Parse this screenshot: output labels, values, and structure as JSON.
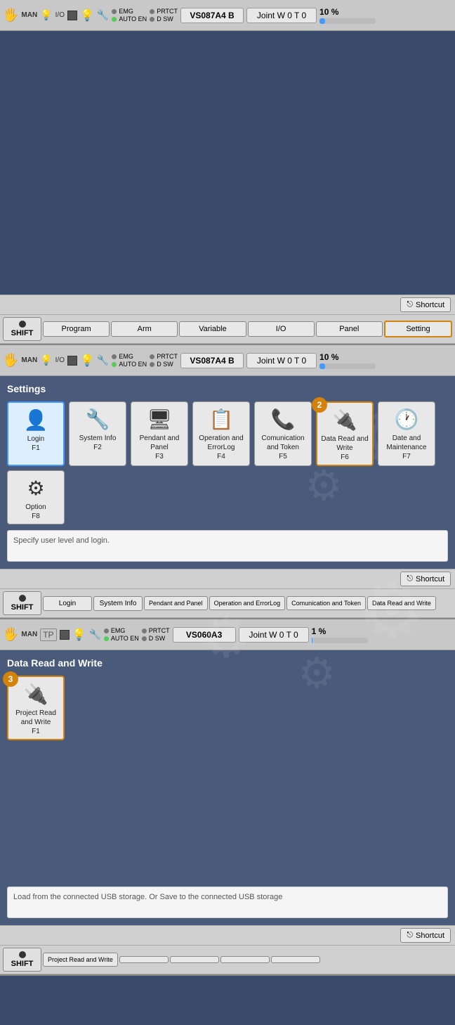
{
  "section1": {
    "statusbar": {
      "man_label": "MAN",
      "io_label": "I/O",
      "emg_label": "EMG",
      "prtct_label": "PRTCT",
      "auto_en_label": "AUTO EN",
      "d_sw_label": "D SW",
      "robot_id": "VS087A4 B",
      "joint_label": "Joint W 0 T 0",
      "percent": "10 %",
      "progress": 10
    },
    "shortcut_label": "Shortcut",
    "nav": {
      "shift_label": "SHIFT",
      "buttons": [
        "Program",
        "Arm",
        "Variable",
        "I/O",
        "Panel",
        "Setting"
      ],
      "active": "Setting"
    }
  },
  "section2": {
    "statusbar": {
      "man_label": "MAN",
      "io_label": "I/O",
      "emg_label": "EMG",
      "prtct_label": "PRTCT",
      "auto_en_label": "AUTO EN",
      "d_sw_label": "D SW",
      "robot_id": "VS087A4 B",
      "joint_label": "Joint W 0 T 0",
      "percent": "10 %",
      "progress": 10
    },
    "settings_title": "Settings",
    "shortcut_label": "Shortcut",
    "badge_num": "2",
    "items": [
      {
        "id": "login",
        "label": "Login\nF1",
        "icon": "👤",
        "active": true
      },
      {
        "id": "sysinfo",
        "label": "System Info\nF2",
        "icon": "🔧",
        "active": false
      },
      {
        "id": "pendant",
        "label": "Pendant and Panel\nF3",
        "icon": "🖥",
        "active": false
      },
      {
        "id": "operation",
        "label": "Operation and ErrorLog\nF4",
        "icon": "📋",
        "active": false
      },
      {
        "id": "communication",
        "label": "Comunication and Token\nF5",
        "icon": "📞",
        "active": false
      },
      {
        "id": "dataread",
        "label": "Data Read and Write\nF6",
        "icon": "🔌",
        "highlighted": true
      },
      {
        "id": "datetime",
        "label": "Date and Maintenance\nF7",
        "icon": "🕐",
        "active": false
      },
      {
        "id": "option",
        "label": "Option\nF8",
        "icon": "⚙",
        "active": false
      }
    ],
    "description": "Specify user level and login.",
    "nav": {
      "shift_label": "SHIFT",
      "buttons": [
        "Login",
        "System Info",
        "Pendant and Panel",
        "Operation and ErrorLog",
        "Comunication and Token",
        "Data Read and Write"
      ]
    }
  },
  "section3": {
    "statusbar": {
      "man_label": "MAN",
      "tp_label": "TP",
      "emg_label": "EMG",
      "prtct_label": "PRTCT",
      "auto_en_label": "AUTO EN",
      "d_sw_label": "D SW",
      "robot_id": "VS060A3",
      "joint_label": "Joint W 0 T 0",
      "percent": "1 %",
      "progress": 1
    },
    "panel_title": "Data Read and Write",
    "shortcut_label": "Shortcut",
    "badge_num": "3",
    "items": [
      {
        "id": "project",
        "label": "Project Read and Write\nF1",
        "icon": "🔌",
        "highlighted": true
      }
    ],
    "description": "Load from the connected USB storage. Or Save to the connected USB storage",
    "nav": {
      "shift_label": "SHIFT",
      "buttons": [
        "Project Read and Write",
        "",
        "",
        "",
        ""
      ]
    }
  }
}
